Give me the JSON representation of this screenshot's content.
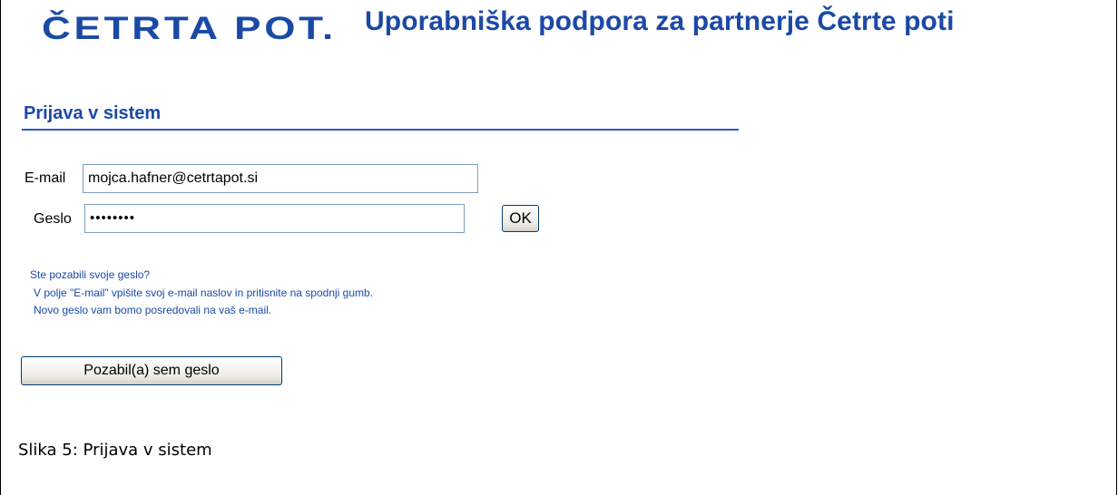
{
  "header": {
    "logo_text": "ČETRTA POT.",
    "title": "Uporabniška podpora za partnerje Četrte poti"
  },
  "login": {
    "section_title": "Prijava v sistem",
    "email_label": "E-mail",
    "email_value": "mojca.hafner@cetrtapot.si",
    "password_label": "Geslo",
    "password_masked": "••••••••",
    "ok_label": "OK"
  },
  "help": {
    "question": "Ste pozabili svoje geslo?",
    "line1": "V polje \"E-mail\" vpišite svoj e-mail naslov in pritisnite na spodnji gumb.",
    "line2": "Novo geslo vam bomo posredovali na vaš e-mail.",
    "forgot_button_label": "Pozabil(a) sem geslo"
  },
  "caption": "Slika 5: Prijava v sistem",
  "colors": {
    "brand_blue": "#1b49a6",
    "rule_blue": "#2a5bb8"
  }
}
